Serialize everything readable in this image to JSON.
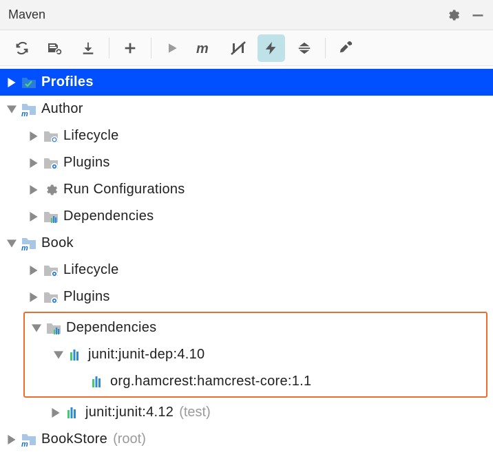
{
  "header": {
    "title": "Maven"
  },
  "tree": {
    "profiles": "Profiles",
    "author": {
      "name": "Author",
      "lifecycle": "Lifecycle",
      "plugins": "Plugins",
      "runconfig": "Run Configurations",
      "dependencies": "Dependencies"
    },
    "book": {
      "name": "Book",
      "lifecycle": "Lifecycle",
      "plugins": "Plugins",
      "dependencies": "Dependencies",
      "dep1": "junit:junit-dep:4.10",
      "dep1_1": "org.hamcrest:hamcrest-core:1.1",
      "dep2": "junit:junit:4.12",
      "dep2_scope": "(test)"
    },
    "bookstore": {
      "name": "BookStore",
      "annot": "(root)"
    }
  }
}
